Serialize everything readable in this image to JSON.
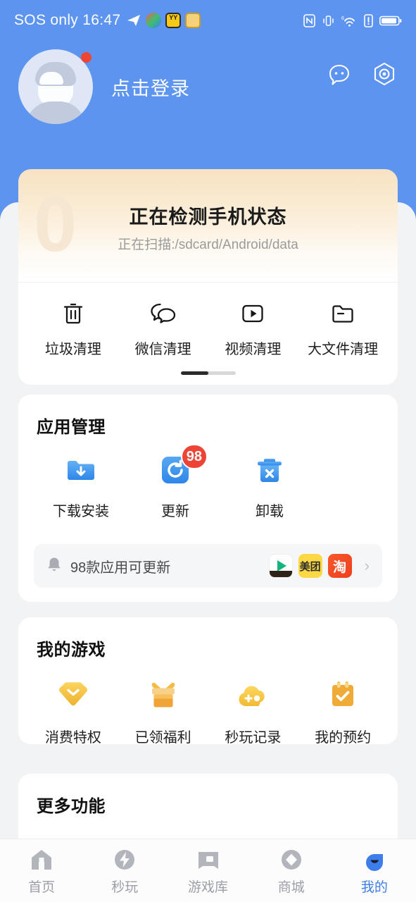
{
  "statusbar": {
    "carrier_time": "SOS only 16:47",
    "app_icons": [
      "telegram-icon",
      "color-ball-icon",
      "yy-icon",
      "kuaiying-icon"
    ],
    "system_icons": [
      "nfc-icon",
      "vibrate-icon",
      "wifi-6-icon",
      "signal-alert-icon",
      "battery-icon"
    ]
  },
  "header": {
    "login_label": "点击登录",
    "chat_icon": "chat-bubble-icon",
    "settings_icon": "hexagon-settings-icon",
    "bg_color": "#5c94f0",
    "has_notification_dot": true
  },
  "scan": {
    "title": "正在检测手机状态",
    "subtitle": "正在扫描:/sdcard/Android/data",
    "ghost_number": "0"
  },
  "tools": {
    "items": [
      {
        "label": "垃圾清理",
        "icon": "trash-icon"
      },
      {
        "label": "微信清理",
        "icon": "wechat-bubbles-icon"
      },
      {
        "label": "视频清理",
        "icon": "video-play-box-icon"
      },
      {
        "label": "大文件清理",
        "icon": "folder-minus-icon"
      }
    ],
    "pager_pages": 2,
    "pager_active": 1
  },
  "app_management": {
    "title": "应用管理",
    "items": [
      {
        "label": "下载安装",
        "icon": "download-folder-icon",
        "badge": ""
      },
      {
        "label": "更新",
        "icon": "refresh-icon",
        "badge": "98"
      },
      {
        "label": "卸载",
        "icon": "uninstall-trash-icon",
        "badge": ""
      }
    ],
    "banner": {
      "bell_icon": "bell-icon",
      "text": "98款应用可更新",
      "app_icons": [
        {
          "name": "video-app-icon",
          "label": ""
        },
        {
          "name": "meituan-app-icon",
          "label": "美团"
        },
        {
          "name": "taobao-app-icon",
          "label": "淘"
        }
      ],
      "chevron": "›"
    }
  },
  "my_games": {
    "title": "我的游戏",
    "items": [
      {
        "label": "消费特权",
        "icon": "diamond-icon"
      },
      {
        "label": "已领福利",
        "icon": "gift-icon"
      },
      {
        "label": "秒玩记录",
        "icon": "cloud-play-icon"
      },
      {
        "label": "我的预约",
        "icon": "calendar-check-icon"
      }
    ]
  },
  "more": {
    "title": "更多功能"
  },
  "bottomnav": {
    "items": [
      {
        "label": "首页",
        "icon": "home-icon",
        "active": false
      },
      {
        "label": "秒玩",
        "icon": "lightning-circle-icon",
        "active": false
      },
      {
        "label": "游戏库",
        "icon": "game-library-icon",
        "active": false
      },
      {
        "label": "商城",
        "icon": "diamond-circle-icon",
        "active": false
      },
      {
        "label": "我的",
        "icon": "profile-drop-icon",
        "active": true
      }
    ],
    "active_color": "#3d7eea",
    "inactive_color": "#9b9fa6"
  }
}
